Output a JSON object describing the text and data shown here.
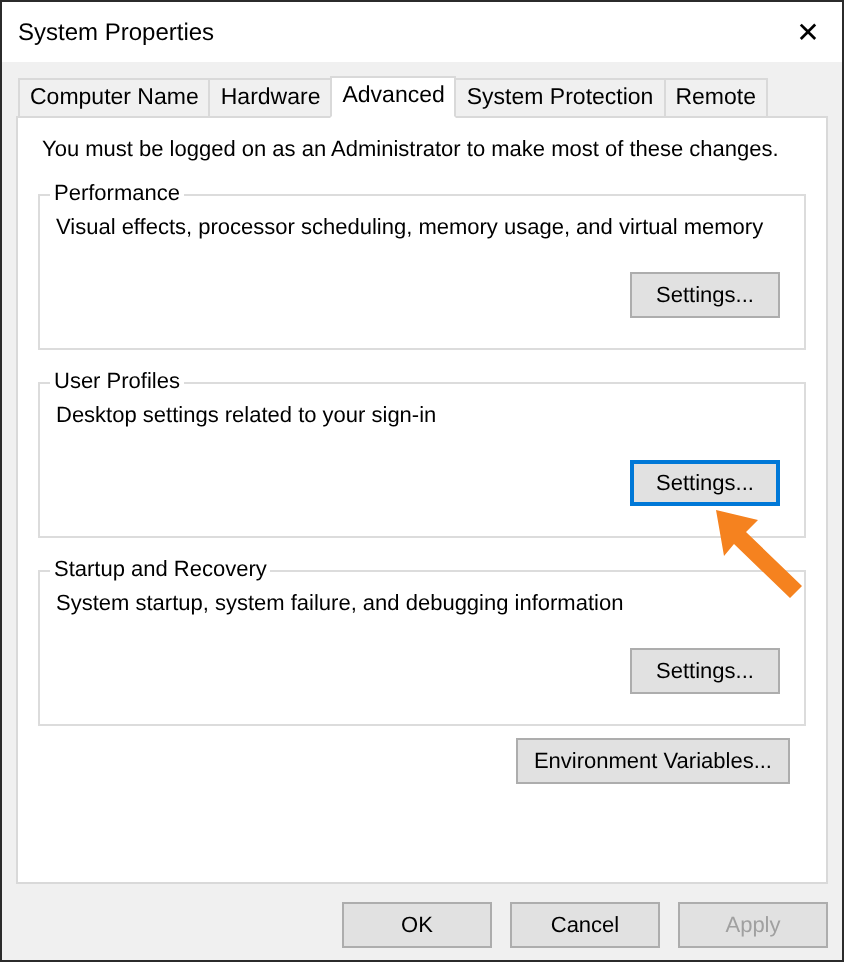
{
  "window": {
    "title": "System Properties",
    "close": "✕"
  },
  "tabs": [
    {
      "label": "Computer Name",
      "selected": false
    },
    {
      "label": "Hardware",
      "selected": false
    },
    {
      "label": "Advanced",
      "selected": true
    },
    {
      "label": "System Protection",
      "selected": false
    },
    {
      "label": "Remote",
      "selected": false
    }
  ],
  "notice": "You must be logged on as an Administrator to make most of these changes.",
  "groups": [
    {
      "title": "Performance",
      "description": "Visual effects, processor scheduling, memory usage, and virtual memory",
      "button": {
        "label": "Settings...",
        "focused": false
      }
    },
    {
      "title": "User Profiles",
      "description": "Desktop settings related to your sign-in",
      "button": {
        "label": "Settings...",
        "focused": true
      },
      "pointer_arrow": true
    },
    {
      "title": "Startup and Recovery",
      "description": "System startup, system failure, and debugging information",
      "button": {
        "label": "Settings...",
        "focused": false
      }
    }
  ],
  "environment_button": {
    "label": "Environment Variables..."
  },
  "dialog_buttons": [
    {
      "label": "OK",
      "disabled": false
    },
    {
      "label": "Cancel",
      "disabled": false
    },
    {
      "label": "Apply",
      "disabled": true
    }
  ]
}
